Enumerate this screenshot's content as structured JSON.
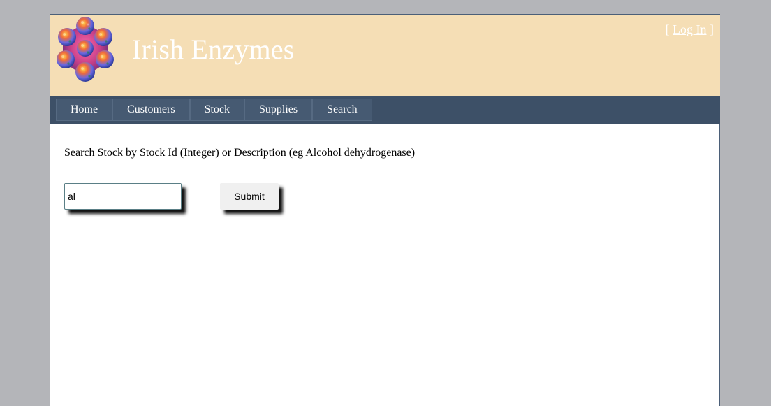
{
  "site": {
    "title": "Irish Enzymes",
    "logo_icon": "enzyme-molecule-logo"
  },
  "auth": {
    "bracket_open": "[ ",
    "login_label": "Log In",
    "bracket_close": " ]"
  },
  "nav": {
    "items": [
      {
        "label": "Home"
      },
      {
        "label": "Customers"
      },
      {
        "label": "Stock"
      },
      {
        "label": "Supplies"
      },
      {
        "label": "Search"
      }
    ]
  },
  "search": {
    "instructions": "Search Stock by Stock Id (Integer) or Description (eg Alcohol dehydrogenase)",
    "value": "al",
    "submit_label": "Submit"
  },
  "colors": {
    "page_background": "#b4b5b9",
    "header_background": "#f5deb5",
    "nav_background": "#3d5067",
    "nav_item_background": "#465a72",
    "title_color": "#ffffff"
  }
}
